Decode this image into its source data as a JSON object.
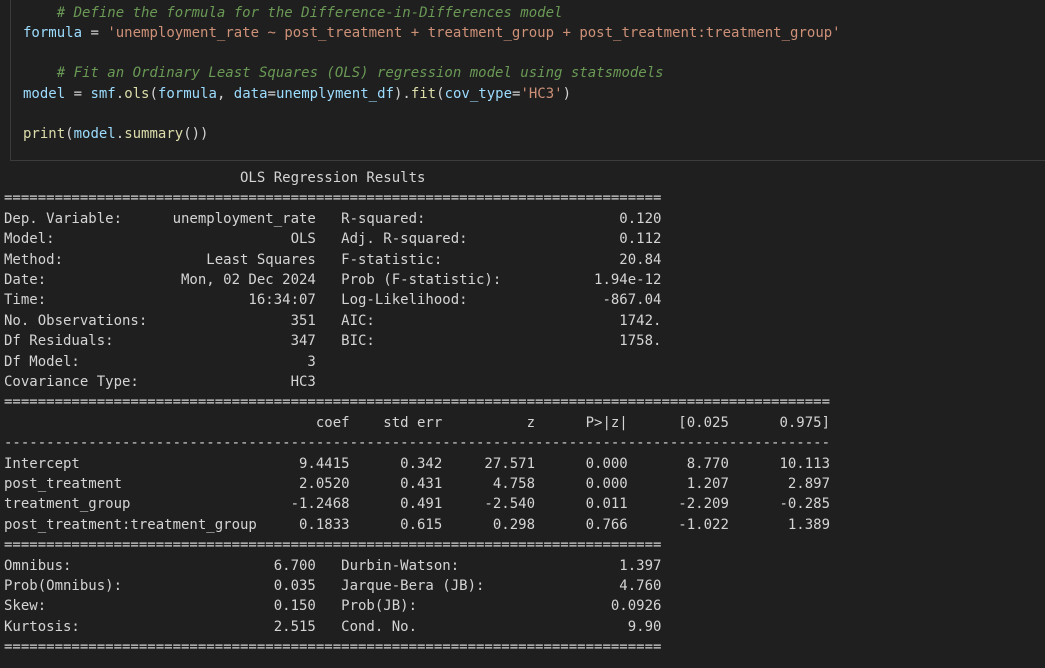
{
  "code_cell": {
    "lines": [
      [
        {
          "t": "    # Define the formula for the Difference-in-Differences model",
          "c": "cm"
        }
      ],
      [
        {
          "t": "formula",
          "c": "va"
        },
        {
          "t": " = ",
          "c": "op"
        },
        {
          "t": "'unemployment_rate ~ post_treatment + treatment_group + post_treatment:treatment_group'",
          "c": "st"
        }
      ],
      [
        {
          "t": "",
          "c": "pu"
        }
      ],
      [
        {
          "t": "    # Fit an Ordinary Least Squares (OLS) regression model using statsmodels",
          "c": "cm"
        }
      ],
      [
        {
          "t": "model",
          "c": "va"
        },
        {
          "t": " = ",
          "c": "op"
        },
        {
          "t": "smf",
          "c": "va"
        },
        {
          "t": ".",
          "c": "op"
        },
        {
          "t": "ols",
          "c": "fn"
        },
        {
          "t": "(",
          "c": "pu"
        },
        {
          "t": "formula",
          "c": "va"
        },
        {
          "t": ", ",
          "c": "pu"
        },
        {
          "t": "data",
          "c": "va"
        },
        {
          "t": "=",
          "c": "op"
        },
        {
          "t": "unemplyment_df",
          "c": "va"
        },
        {
          "t": ").",
          "c": "pu"
        },
        {
          "t": "fit",
          "c": "fn"
        },
        {
          "t": "(",
          "c": "pu"
        },
        {
          "t": "cov_type",
          "c": "va"
        },
        {
          "t": "=",
          "c": "op"
        },
        {
          "t": "'HC3'",
          "c": "st"
        },
        {
          "t": ")",
          "c": "pu"
        }
      ],
      [
        {
          "t": "",
          "c": "pu"
        }
      ],
      [
        {
          "t": "print",
          "c": "fn"
        },
        {
          "t": "(",
          "c": "pu"
        },
        {
          "t": "model",
          "c": "va"
        },
        {
          "t": ".",
          "c": "op"
        },
        {
          "t": "summary",
          "c": "fn"
        },
        {
          "t": "())",
          "c": "pu"
        }
      ]
    ]
  },
  "output": {
    "lines": [
      "                            OLS Regression Results                            ",
      "==============================================================================",
      "Dep. Variable:      unemployment_rate   R-squared:                       0.120",
      "Model:                            OLS   Adj. R-squared:                  0.112",
      "Method:                 Least Squares   F-statistic:                     20.84",
      "Date:                Mon, 02 Dec 2024   Prob (F-statistic):           1.94e-12",
      "Time:                        16:34:07   Log-Likelihood:                -867.04",
      "No. Observations:                 351   AIC:                             1742.",
      "Df Residuals:                     347   BIC:                             1758.",
      "Df Model:                           3                                         ",
      "Covariance Type:                  HC3                                         ",
      "==================================================================================================",
      "                                     coef    std err          z      P>|z|      [0.025      0.975]",
      "--------------------------------------------------------------------------------------------------",
      "Intercept                          9.4415      0.342     27.571      0.000       8.770      10.113",
      "post_treatment                     2.0520      0.431      4.758      0.000       1.207       2.897",
      "treatment_group                   -1.2468      0.491     -2.540      0.011      -2.209      -0.285",
      "post_treatment:treatment_group     0.1833      0.615      0.298      0.766      -1.022       1.389",
      "==============================================================================",
      "Omnibus:                        6.700   Durbin-Watson:                   1.397",
      "Prob(Omnibus):                  0.035   Jarque-Bera (JB):                4.760",
      "Skew:                           0.150   Prob(JB):                       0.0926",
      "Kurtosis:                       2.515   Cond. No.                         9.90",
      "=============================================================================="
    ]
  }
}
